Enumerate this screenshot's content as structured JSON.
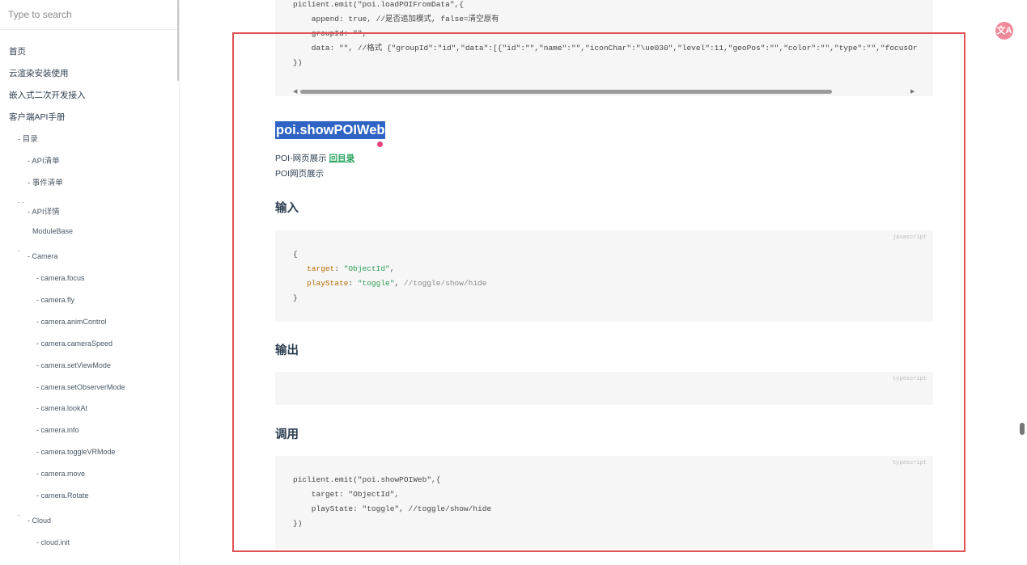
{
  "search": {
    "placeholder": "Type to search"
  },
  "sidebar": {
    "items": [
      {
        "label": "首页"
      },
      {
        "label": "云渲染安装使用"
      },
      {
        "label": "嵌入式二次开发接入"
      },
      {
        "label": "客户端API手册"
      },
      {
        "label": "- 目录"
      },
      {
        "label": "- API清单"
      },
      {
        "label": "- 事件清单"
      },
      {
        "label": "- API详情"
      },
      {
        "label": "ModuleBase"
      },
      {
        "label": "- Camera"
      },
      {
        "label": "- camera.focus"
      },
      {
        "label": "- camera.fly"
      },
      {
        "label": "- camera.animControl"
      },
      {
        "label": "- camera.cameraSpeed"
      },
      {
        "label": "- camera.setViewMode"
      },
      {
        "label": "- camera.setObserverMode"
      },
      {
        "label": "- camera.lookAt"
      },
      {
        "label": "- camera.info"
      },
      {
        "label": "- camera.toggleVRMode"
      },
      {
        "label": "- camera.move"
      },
      {
        "label": "- camera.Rotate"
      },
      {
        "label": "- Cloud"
      },
      {
        "label": "- cloud.init"
      }
    ]
  },
  "top_code": {
    "line1": "piclient.emit(\"poi.loadPOIFromData\",{",
    "line2": "    append: true, //是否追加模式, false=清空原有",
    "line3": "    groupId: \"\",",
    "line4": "    data: \"\", //格式 {\"groupId\":\"id\",\"data\":[{\"id\":\"\",\"name\":\"\",\"iconChar\":\"\\ue030\",\"level\":11,\"geoPos\":\"\",\"color\":\"\",\"type\":\"\",\"focusOr",
    "line5": "})"
  },
  "api": {
    "title": "poi.showPOIWeb",
    "desc_prefix": "POI-网页展示",
    "back_link": "回目录",
    "desc2": "POI网页展示"
  },
  "input_section": {
    "heading": "输入",
    "lang": "javascript",
    "open": "{",
    "target_key": "target",
    "target_val": "\"ObjectId\"",
    "play_key": "playState",
    "play_val": "\"toggle\"",
    "play_comment": "//toggle/show/hide",
    "close": "}"
  },
  "output_section": {
    "heading": "输出",
    "lang": "typescript"
  },
  "call_section": {
    "heading": "调用",
    "lang": "typescript",
    "line1": "piclient.emit(\"poi.showPOIWeb\",{",
    "line2": "    target: \"ObjectId\",",
    "line3": "    playState: \"toggle\", //toggle/show/hide",
    "line4": "})"
  },
  "translate_icon": "文A",
  "colors": {
    "highlight": "#2f64c4",
    "link": "#28a55f",
    "frame": "#e05252",
    "string": "#2e9b52",
    "key": "#b76b01"
  }
}
